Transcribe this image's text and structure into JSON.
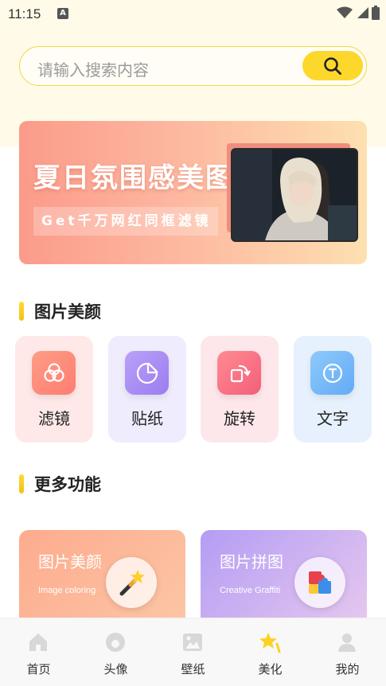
{
  "status_bar": {
    "time": "11:15",
    "notification_glyph": "A"
  },
  "search": {
    "placeholder": "请输入搜索内容",
    "icon": "search-icon",
    "accent": "#fcd82c"
  },
  "banner": {
    "title": "夏日氛围感美图",
    "subtitle": "Get千万网红同框滤镜"
  },
  "section_beauty": {
    "title": "图片美颜"
  },
  "features": [
    {
      "label": "滤镜",
      "icon": "filter-icon",
      "color": "#fd8e7d"
    },
    {
      "label": "贴纸",
      "icon": "sticker-icon",
      "color": "#a98df5"
    },
    {
      "label": "旋转",
      "icon": "rotate-icon",
      "color": "#f86f86"
    },
    {
      "label": "文字",
      "icon": "text-icon",
      "color": "#6fb5f8"
    }
  ],
  "section_more": {
    "title": "更多功能"
  },
  "promos": [
    {
      "title": "图片美颜",
      "subtitle": "Image coloring",
      "icon": "magic-wand-icon"
    },
    {
      "title": "图片拼图",
      "subtitle": "Creative Graffiti",
      "icon": "puzzle-icon"
    }
  ],
  "bottom_nav": [
    {
      "label": "首页",
      "icon": "home-icon",
      "active": false
    },
    {
      "label": "头像",
      "icon": "avatar-icon",
      "active": false
    },
    {
      "label": "壁纸",
      "icon": "wallpaper-icon",
      "active": false
    },
    {
      "label": "美化",
      "icon": "beautify-star-icon",
      "active": true
    },
    {
      "label": "我的",
      "icon": "profile-icon",
      "active": false
    }
  ]
}
